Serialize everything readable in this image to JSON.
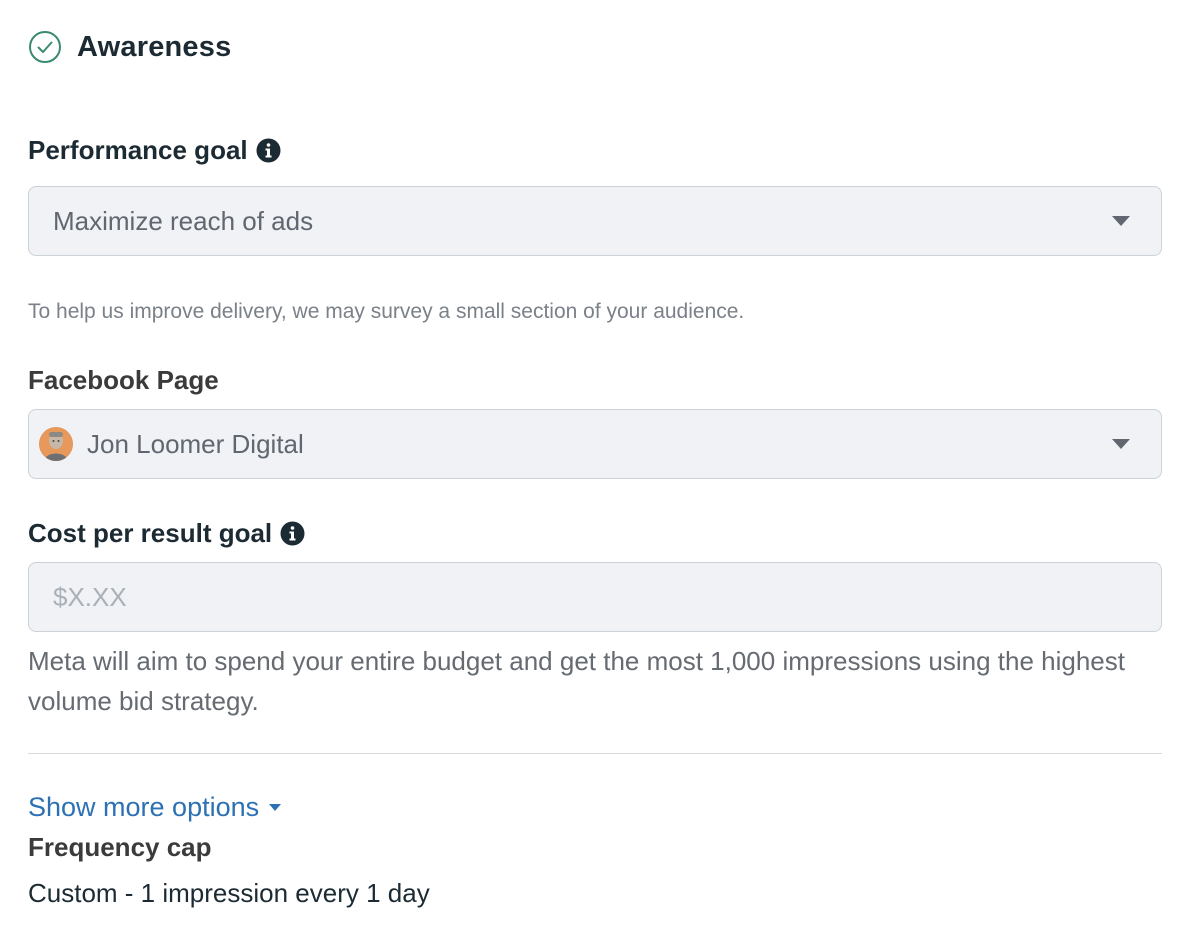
{
  "objective": {
    "title": "Awareness",
    "icon": "check-circle-icon"
  },
  "performance_goal": {
    "label": "Performance goal",
    "info_icon": "info-icon",
    "selected_value": "Maximize reach of ads",
    "helper_text": "To help us improve delivery, we may survey a small section of your audience."
  },
  "facebook_page": {
    "label": "Facebook Page",
    "selected_value": "Jon Loomer Digital",
    "avatar_icon": "page-avatar"
  },
  "cost_per_result": {
    "label": "Cost per result goal",
    "info_icon": "info-icon",
    "placeholder": "$X.XX",
    "value": "",
    "description": "Meta will aim to spend your entire budget and get the most 1,000 impressions using the highest volume bid strategy."
  },
  "more_options": {
    "link_label": "Show more options"
  },
  "frequency_cap": {
    "label": "Frequency cap",
    "value": "Custom - 1 impression every 1 day"
  },
  "colors": {
    "accent_link": "#2b71b4",
    "success_check": "#3a8a6e",
    "field_background": "#f0f2f5",
    "text_primary": "#1c2b33"
  }
}
